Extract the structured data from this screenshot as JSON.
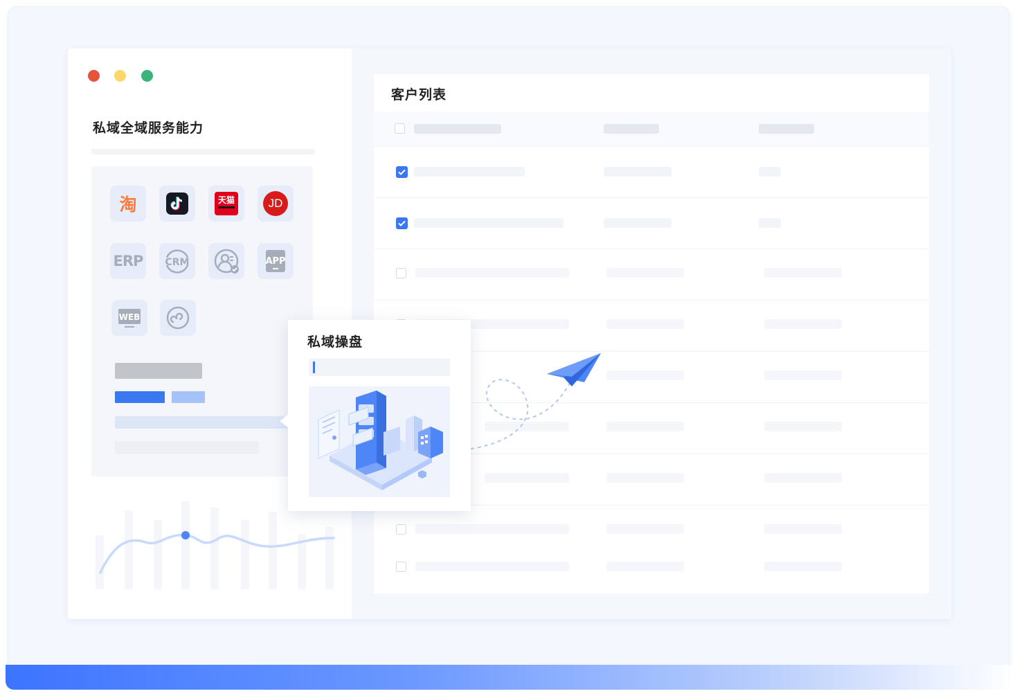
{
  "left_panel": {
    "title": "私域全域服务能力",
    "window_dots": [
      {
        "name": "close",
        "color": "#e5533b"
      },
      {
        "name": "minimize",
        "color": "#fbd968"
      },
      {
        "name": "maximize",
        "color": "#3bb47a"
      }
    ],
    "channel_icons": [
      {
        "name": "taobao",
        "label": "淘"
      },
      {
        "name": "douyin",
        "label": "♪"
      },
      {
        "name": "tmall",
        "label": "天猫"
      },
      {
        "name": "jd",
        "label": "JD"
      },
      {
        "name": "erp",
        "label": "ERP"
      },
      {
        "name": "crm",
        "label": "CRM"
      },
      {
        "name": "user-profile",
        "label": ""
      },
      {
        "name": "app",
        "label": "APP"
      },
      {
        "name": "web",
        "label": "WEB"
      },
      {
        "name": "mini-program",
        "label": ""
      }
    ]
  },
  "popup": {
    "title": "私域操盘"
  },
  "customer_list": {
    "title": "客户列表",
    "rows": [
      {
        "checked": true
      },
      {
        "checked": true
      },
      {
        "checked": false
      },
      {
        "checked": false
      },
      {
        "checked": false
      },
      {
        "checked": false
      },
      {
        "checked": false
      },
      {
        "checked": false
      },
      {
        "checked": false
      }
    ]
  },
  "colors": {
    "accent": "#3a78f2",
    "light_accent": "#a6c2fb",
    "panel_bg": "#f3f7fe"
  }
}
